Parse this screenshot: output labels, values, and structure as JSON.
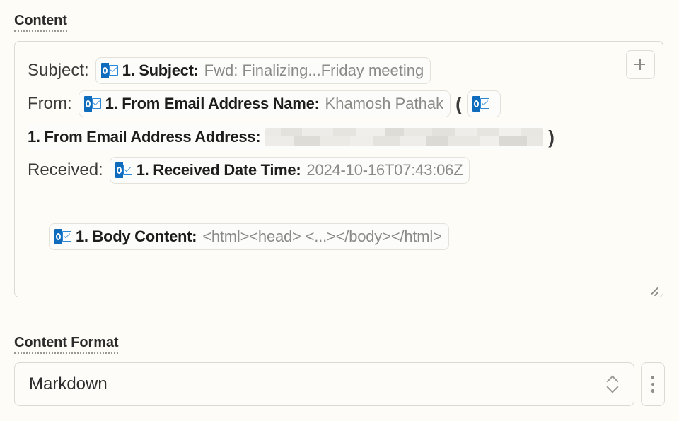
{
  "content_section": {
    "label": "Content",
    "add_button_icon": "plus-icon",
    "resize_handle_icon": "resize-grip-icon",
    "rows": [
      {
        "prefix": "Subject:",
        "tokens": [
          {
            "icon": "outlook-icon",
            "key": "1. Subject:",
            "value": "Fwd: Finalizing...Friday meeting"
          }
        ]
      },
      {
        "prefix": "From:",
        "tokens": [
          {
            "icon": "outlook-icon",
            "key": "1. From Email Address Name:",
            "value": "Khamosh Pathak"
          }
        ],
        "open_paren": "(",
        "clipped_token": {
          "icon": "outlook-icon",
          "key": "",
          "value": ""
        }
      },
      {
        "prefix": "",
        "continuation_key": "1. From Email Address Address:",
        "value_redacted": true,
        "close_paren": ")"
      },
      {
        "prefix": "Received:",
        "tokens": [
          {
            "icon": "outlook-icon",
            "key": "1. Received Date Time:",
            "value": "2024-10-16T07:43:06Z"
          }
        ]
      }
    ],
    "body_token": {
      "icon": "outlook-icon",
      "key": "1. Body Content:",
      "value": "<html><head>  <...></body></html>"
    }
  },
  "format_section": {
    "label": "Content Format",
    "selected_value": "Markdown",
    "dropdown_icon": "chevron-up-down-icon",
    "menu_button_icon": "kebab-menu-icon"
  },
  "colors": {
    "page_background": "#fdfcf7",
    "border": "#dcdad2",
    "token_border": "#e3e1da",
    "text_primary": "#2c2c2c",
    "text_muted": "#8a8a86",
    "outlook_blue": "#0f6cbd",
    "outlook_light_blue": "#2b88d8"
  }
}
